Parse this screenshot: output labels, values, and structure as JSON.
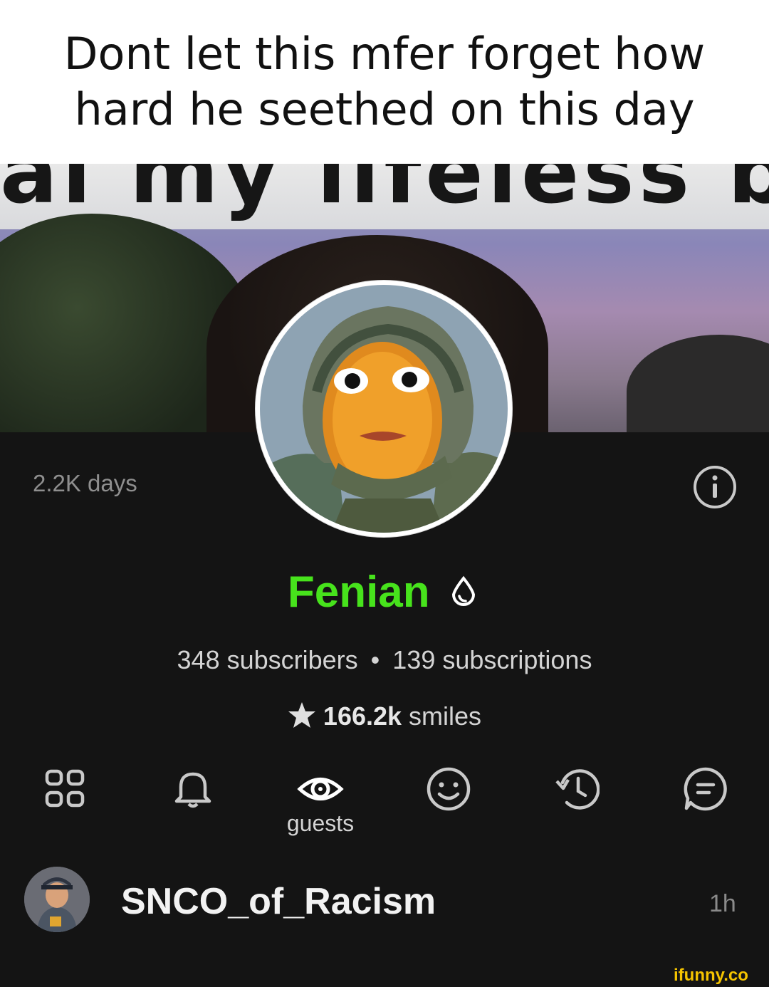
{
  "caption": "Dont let this mfer forget how hard he seethed on this day",
  "banner": {
    "overlay_text": "al my lifeless body"
  },
  "profile": {
    "account_age": "2.2K days",
    "name": "Fenian",
    "subscribers": "348 subscribers",
    "separator": "•",
    "subscriptions": "139 subscriptions",
    "smiles_count": "166.2k",
    "smiles_label": "smiles",
    "name_color": "#47e31c"
  },
  "tabs": [
    {
      "icon": "grid-icon"
    },
    {
      "icon": "bell-icon"
    },
    {
      "icon": "eye-icon",
      "label": "guests"
    },
    {
      "icon": "smile-icon"
    },
    {
      "icon": "history-icon"
    },
    {
      "icon": "chat-icon"
    }
  ],
  "comment": {
    "username": "SNCO_of_Racism",
    "time": "1h"
  },
  "watermark": "ifunny.co"
}
